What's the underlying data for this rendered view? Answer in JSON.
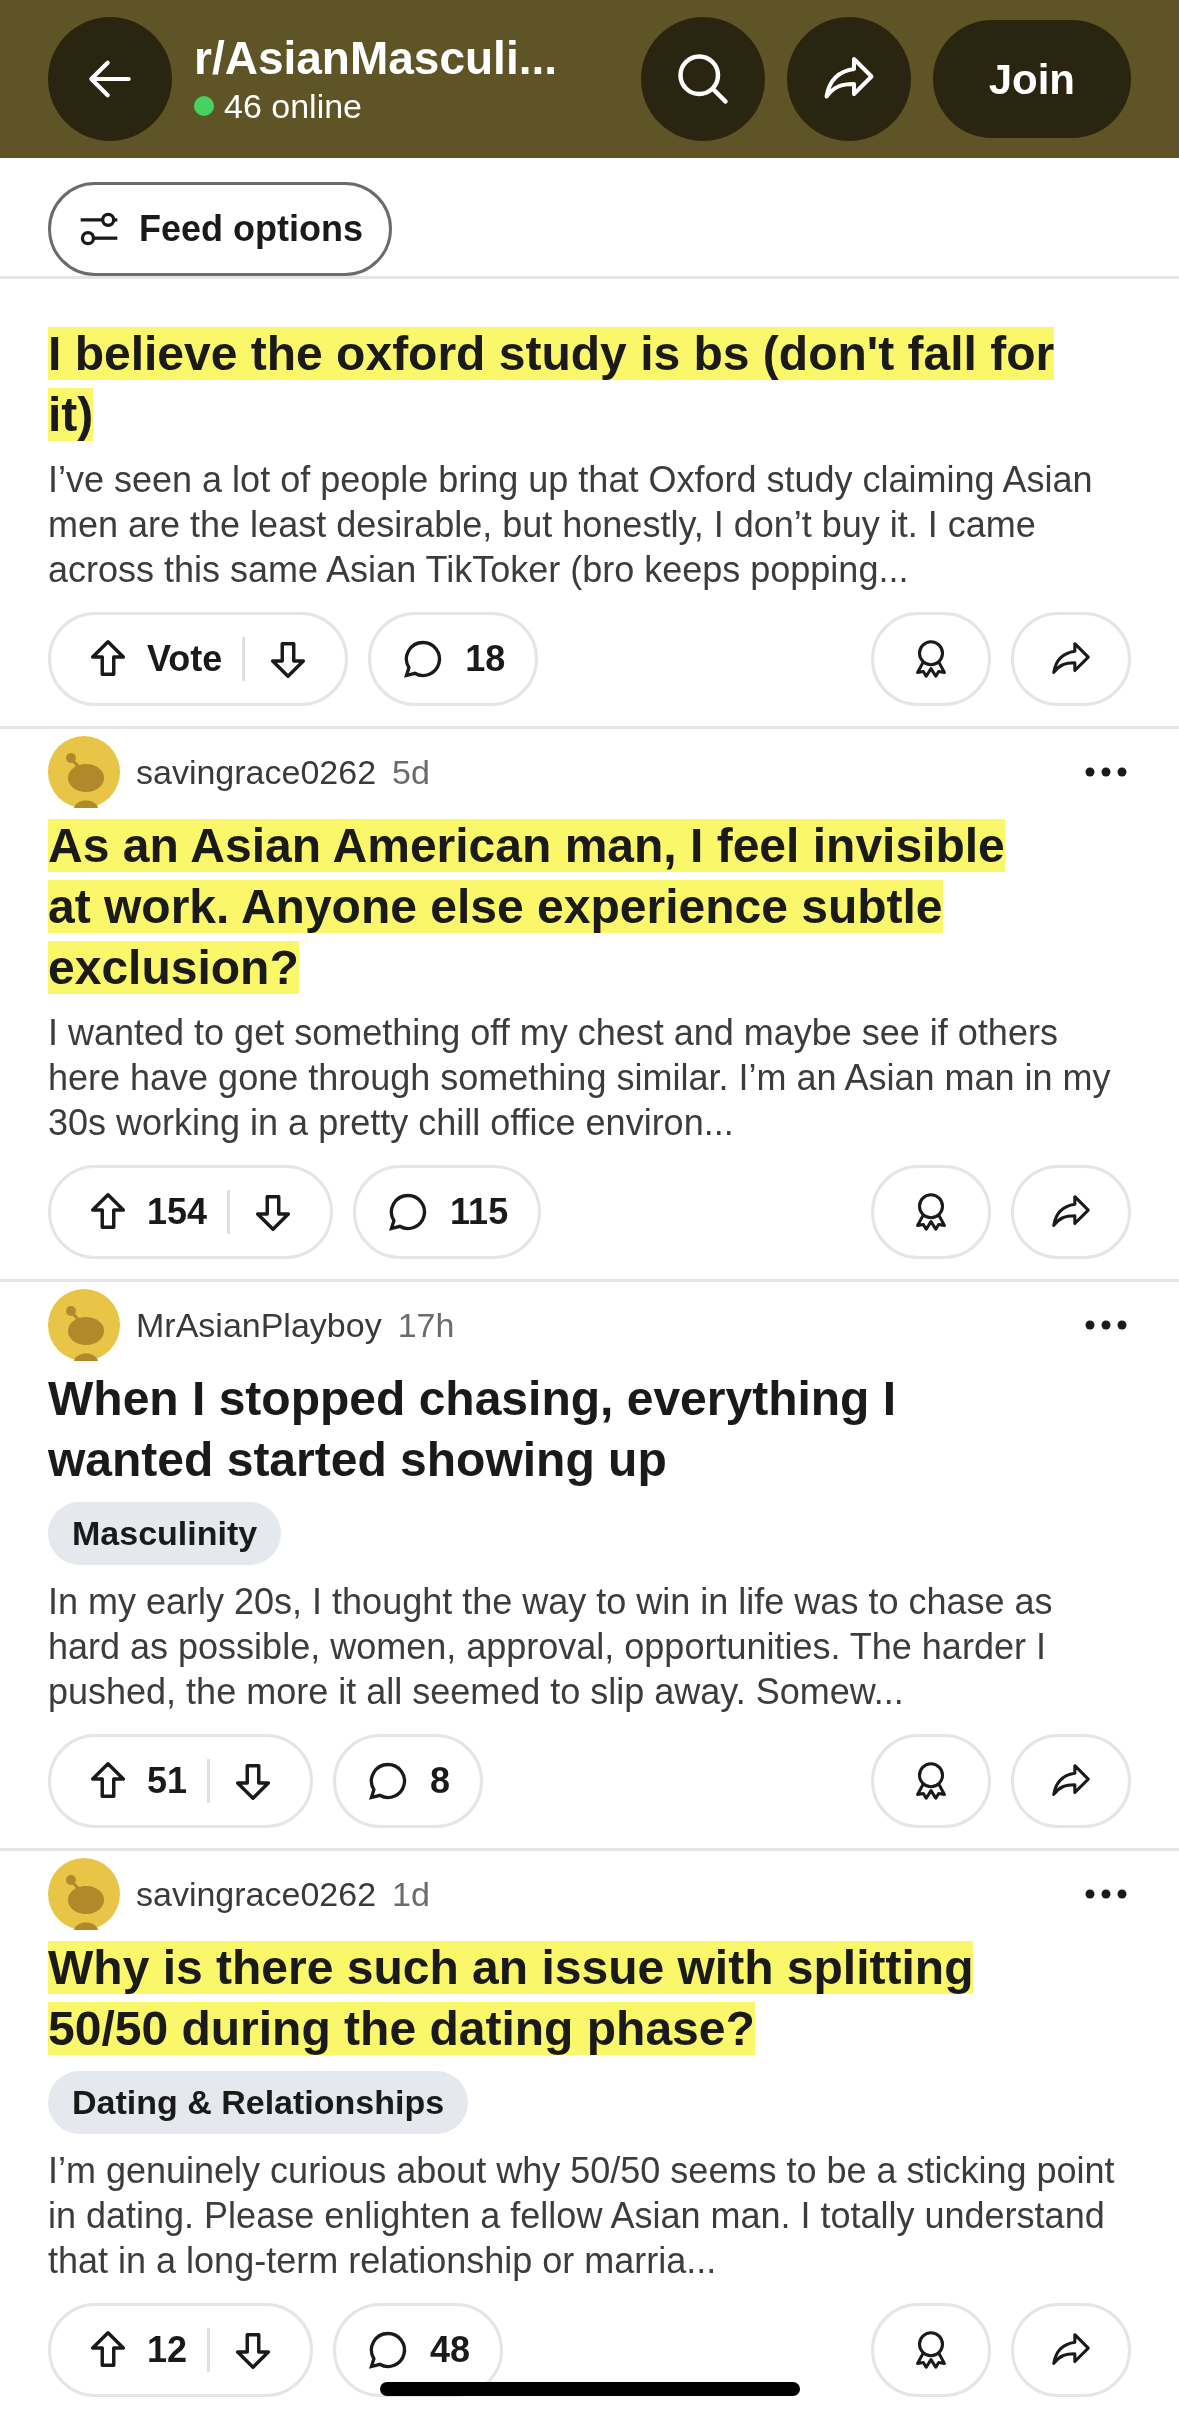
{
  "header": {
    "title": "r/AsianMasculi...",
    "online": "46 online",
    "join": "Join"
  },
  "feed_options": "Feed options",
  "posts": [
    {
      "title": "I believe the oxford study is bs (don't fall for it)",
      "highlighted": true,
      "body": "I’ve seen a lot of people bring up that Oxford study claiming Asian men are the least desirable, but honestly, I don’t buy it. I came across this same Asian TikToker (bro keeps popping...",
      "votes": "Vote",
      "comments": "18"
    },
    {
      "author": "savingrace0262",
      "age": "5d",
      "title": "As an Asian American man, I feel invisible at work. Anyone else experience subtle exclusion?",
      "highlighted": true,
      "body": "I wanted to get something off my chest and maybe see if others here have gone through something similar. I’m an Asian man in my 30s working in a pretty chill office environ...",
      "votes": "154",
      "comments": "115"
    },
    {
      "author": "MrAsianPlayboy",
      "age": "17h",
      "title": "When I stopped chasing, everything I wanted started showing up",
      "highlighted": false,
      "flair": "Masculinity",
      "body": "In my early 20s, I thought the way to win in life was to chase as hard as possible, women, approval, opportunities. The harder I pushed, the more it all seemed to slip away. Somew...",
      "votes": "51",
      "comments": "8"
    },
    {
      "author": "savingrace0262",
      "age": "1d",
      "title": "Why is there such an issue with splitting 50/50 during the dating phase?",
      "highlighted": true,
      "flair": "Dating & Relationships",
      "body": "I’m genuinely curious about why 50/50 seems to be a sticking point in dating. Please enlighten a fellow Asian man. I totally understand that in a long-term relationship or marria...",
      "votes": "12",
      "comments": "48"
    }
  ]
}
